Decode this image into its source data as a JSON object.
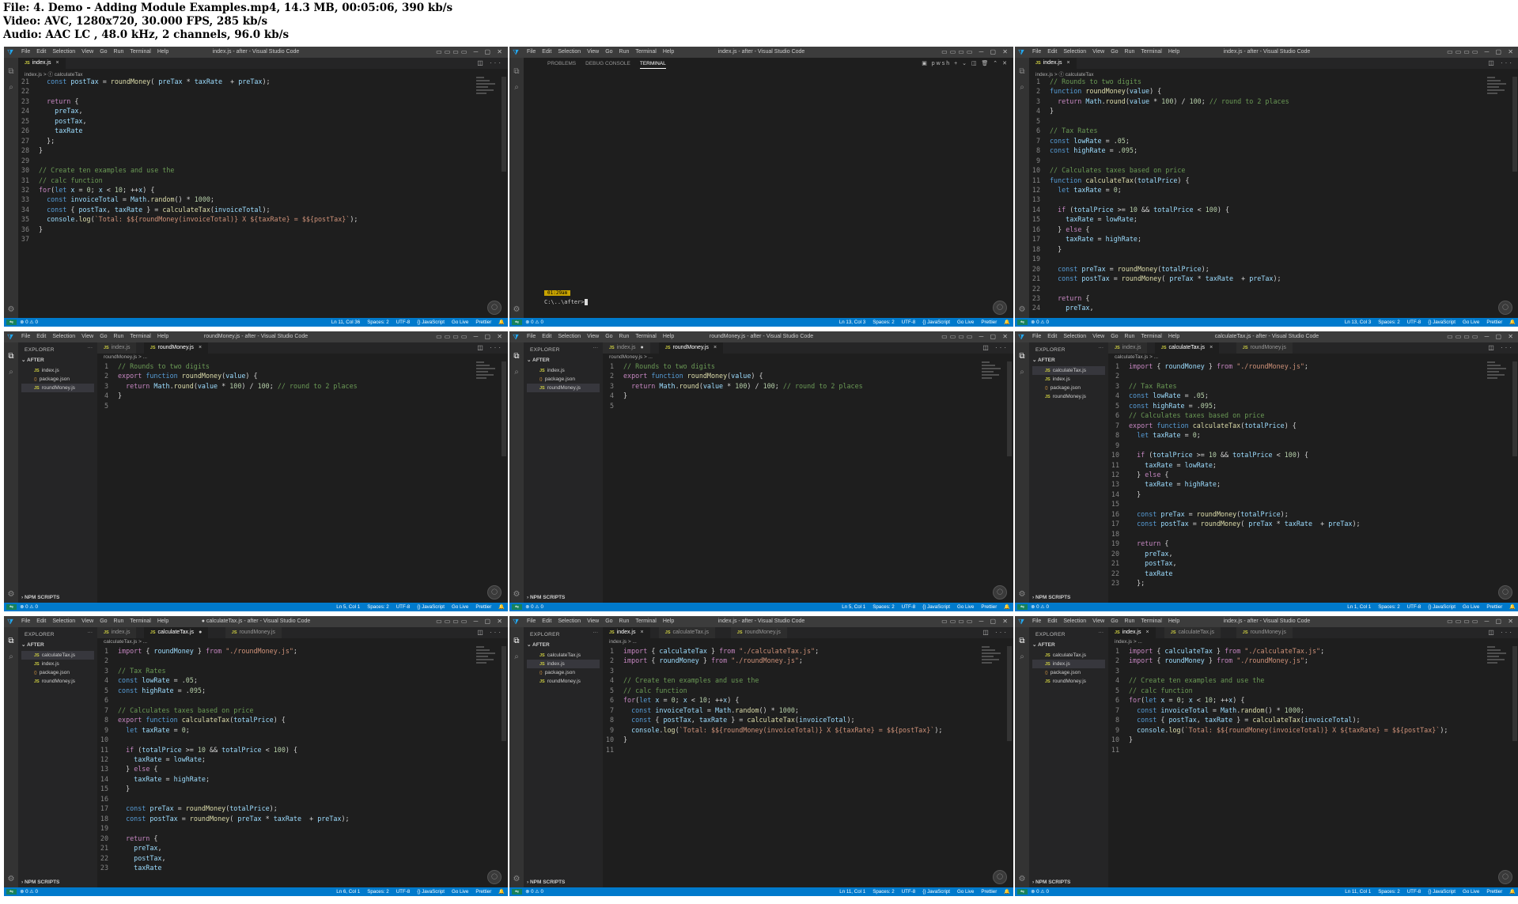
{
  "header": {
    "file_line": "File: 4. Demo - Adding Module Examples.mp4, 14.3 MB, 00:05:06, 390 kb/s",
    "video_line": "Video: AVC, 1280x720, 30.000 FPS, 285 kb/s",
    "audio_line": "Audio: AAC LC , 48.0 kHz, 2 channels, 96.0 kb/s"
  },
  "menu": [
    "File",
    "Edit",
    "Selection",
    "View",
    "Go",
    "Run",
    "Terminal",
    "Help"
  ],
  "status_common": {
    "errors": "⊗ 0 ⚠ 0",
    "spaces": "Spaces: 2",
    "encoding": "UTF-8",
    "language": "{} JavaScript",
    "golive": "Go Live",
    "prettier": "Prettier"
  },
  "explorer": {
    "title": "EXPLORER",
    "folder": "AFTER",
    "npm": "NPM SCRIPTS"
  },
  "panel": {
    "tabs": [
      "PROBLEMS",
      "DEBUG CONSOLE",
      "TERMINAL"
    ],
    "time": "01:29am",
    "prompt": "C:\\..\\after>",
    "shell": "pwsh"
  },
  "cells": [
    {
      "title": "index.js - after - Visual Studio Code",
      "tabs": [
        {
          "label": "index.js",
          "active": true,
          "close": "×"
        }
      ],
      "breadcrumb": "index.js > ⓕ calculateTax",
      "cursor": "Ln 11, Col 36",
      "first_line": 21,
      "lines": [
        "  const postTax = roundMoney( preTax * taxRate  + preTax);",
        "",
        "  return {",
        "    preTax,",
        "    postTax,",
        "    taxRate",
        "  };",
        "}",
        "",
        "// Create ten examples and use the",
        "// calc function",
        "for(let x = 0; x < 10; ++x) {",
        "  const invoiceTotal = Math.random() * 1000;",
        "  const { postTax, taxRate } = calculateTax(invoiceTotal);",
        "  console.log(`Total: $${roundMoney(invoiceTotal)} X ${taxRate} = $${postTax}`);",
        "}",
        ""
      ]
    },
    {
      "title": "index.js - after - Visual Studio Code",
      "cursor": "Ln 13, Col 3"
    },
    {
      "title": "index.js - after - Visual Studio Code",
      "tabs": [
        {
          "label": "index.js",
          "active": true,
          "close": "×"
        }
      ],
      "breadcrumb": "index.js > ⓕ calculateTax",
      "cursor": "Ln 13, Col 3",
      "first_line": 1,
      "lines": [
        "// Rounds to two digits",
        "function roundMoney(value) {",
        "  return Math.round(value * 100) / 100; // round to 2 places",
        "}",
        "",
        "// Tax Rates",
        "const lowRate = .05;",
        "const highRate = .095;",
        "",
        "// Calculates taxes based on price",
        "function calculateTax(totalPrice) {",
        "  let taxRate = 0;",
        "",
        "  if (totalPrice >= 10 && totalPrice < 100) {",
        "    taxRate = lowRate;",
        "  } else {",
        "    taxRate = highRate;",
        "  }",
        "",
        "  const preTax = roundMoney(totalPrice);",
        "  const postTax = roundMoney( preTax * taxRate  + preTax);",
        "",
        "  return {",
        "    preTax,"
      ]
    },
    {
      "title": "roundMoney.js - after - Visual Studio Code",
      "tabs": [
        {
          "label": "index.js",
          "active": false,
          "close": ""
        },
        {
          "label": "roundMoney.js",
          "active": true,
          "close": "×"
        }
      ],
      "files": [
        "index.js",
        "package.json",
        "roundMoney.js"
      ],
      "selected_file": 2,
      "breadcrumb": "roundMoney.js > ...",
      "cursor": "Ln 5, Col 1",
      "first_line": 1,
      "lines": [
        "// Rounds to two digits",
        "export function roundMoney(value) {",
        "  return Math.round(value * 100) / 100; // round to 2 places",
        "}",
        ""
      ]
    },
    {
      "title": "roundMoney.js - after - Visual Studio Code",
      "tabs": [
        {
          "label": "index.js",
          "active": false,
          "close": "●"
        },
        {
          "label": "roundMoney.js",
          "active": true,
          "close": "×"
        }
      ],
      "files": [
        "index.js",
        "package.json",
        "roundMoney.js"
      ],
      "selected_file": 2,
      "breadcrumb": "roundMoney.js > ...",
      "cursor": "Ln 5, Col 1",
      "first_line": 1,
      "lines": [
        "// Rounds to two digits",
        "export function roundMoney(value) {",
        "  return Math.round(value * 100) / 100; // round to 2 places",
        "}",
        ""
      ]
    },
    {
      "title": "calculateTax.js - after - Visual Studio Code",
      "tabs": [
        {
          "label": "index.js",
          "active": false,
          "close": ""
        },
        {
          "label": "calculateTax.js",
          "active": true,
          "close": "×"
        },
        {
          "label": "roundMoney.js",
          "active": false,
          "close": ""
        }
      ],
      "files": [
        "calculateTax.js",
        "index.js",
        "package.json",
        "roundMoney.js"
      ],
      "selected_file": 0,
      "breadcrumb": "calculateTax.js > ...",
      "cursor": "Ln 1, Col 1",
      "first_line": 1,
      "lines": [
        "import { roundMoney } from \"./roundMoney.js\";",
        "",
        "// Tax Rates",
        "const lowRate = .05;",
        "const highRate = .095;",
        "// Calculates taxes based on price",
        "export function calculateTax(totalPrice) {",
        "  let taxRate = 0;",
        "",
        "  if (totalPrice >= 10 && totalPrice < 100) {",
        "    taxRate = lowRate;",
        "  } else {",
        "    taxRate = highRate;",
        "  }",
        "",
        "  const preTax = roundMoney(totalPrice);",
        "  const postTax = roundMoney( preTax * taxRate  + preTax);",
        "",
        "  return {",
        "    preTax,",
        "    postTax,",
        "    taxRate",
        "  };"
      ]
    },
    {
      "title": "● calculateTax.js - after - Visual Studio Code",
      "tabs": [
        {
          "label": "index.js",
          "active": false,
          "close": ""
        },
        {
          "label": "calculateTax.js",
          "active": true,
          "close": "●"
        },
        {
          "label": "roundMoney.js",
          "active": false,
          "close": ""
        }
      ],
      "files": [
        "calculateTax.js",
        "index.js",
        "package.json",
        "roundMoney.js"
      ],
      "selected_file": 0,
      "breadcrumb": "calculateTax.js > ...",
      "cursor": "Ln 6, Col 1",
      "first_line": 1,
      "lines": [
        "import { roundMoney } from \"./roundMoney.js\";",
        "",
        "// Tax Rates",
        "const lowRate = .05;",
        "const highRate = .095;",
        "",
        "// Calculates taxes based on price",
        "export function calculateTax(totalPrice) {",
        "  let taxRate = 0;",
        "",
        "  if (totalPrice >= 10 && totalPrice < 100) {",
        "    taxRate = lowRate;",
        "  } else {",
        "    taxRate = highRate;",
        "  }",
        "",
        "  const preTax = roundMoney(totalPrice);",
        "  const postTax = roundMoney( preTax * taxRate  + preTax);",
        "",
        "  return {",
        "    preTax,",
        "    postTax,",
        "    taxRate"
      ]
    },
    {
      "title": "index.js - after - Visual Studio Code",
      "tabs": [
        {
          "label": "index.js",
          "active": true,
          "close": "×"
        },
        {
          "label": "calculateTax.js",
          "active": false,
          "close": ""
        },
        {
          "label": "roundMoney.js",
          "active": false,
          "close": ""
        }
      ],
      "files": [
        "calculateTax.js",
        "index.js",
        "package.json",
        "roundMoney.js"
      ],
      "selected_file": 1,
      "breadcrumb": "index.js > ...",
      "cursor": "Ln 11, Col 1",
      "first_line": 1,
      "lines": [
        "import { calculateTax } from \"./calculateTax.js\";",
        "import { roundMoney } from \"./roundMoney.js\";",
        "",
        "// Create ten examples and use the",
        "// calc function",
        "for(let x = 0; x < 10; ++x) {",
        "  const invoiceTotal = Math.random() * 1000;",
        "  const { postTax, taxRate } = calculateTax(invoiceTotal);",
        "  console.log(`Total: $${roundMoney(invoiceTotal)} X ${taxRate} = $${postTax}`);",
        "}",
        ""
      ]
    },
    {
      "title": "index.js - after - Visual Studio Code",
      "tabs": [
        {
          "label": "index.js",
          "active": true,
          "close": "×"
        },
        {
          "label": "calculateTax.js",
          "active": false,
          "close": ""
        },
        {
          "label": "roundMoney.js",
          "active": false,
          "close": ""
        }
      ],
      "files": [
        "calculateTax.js",
        "index.js",
        "package.json",
        "roundMoney.js"
      ],
      "selected_file": 1,
      "breadcrumb": "index.js > ...",
      "cursor": "Ln 11, Col 1",
      "first_line": 1,
      "lines": [
        "import { calculateTax } from \"./calculateTax.js\";",
        "import { roundMoney } from \"./roundMoney.js\";",
        "",
        "// Create ten examples and use the",
        "// calc function",
        "for(let x = 0; x < 10; ++x) {",
        "  const invoiceTotal = Math.random() * 1000;",
        "  const { postTax, taxRate } = calculateTax(invoiceTotal);",
        "  console.log(`Total: $${roundMoney(invoiceTotal)} X ${taxRate} = $${postTax}`);",
        "}",
        ""
      ]
    }
  ]
}
